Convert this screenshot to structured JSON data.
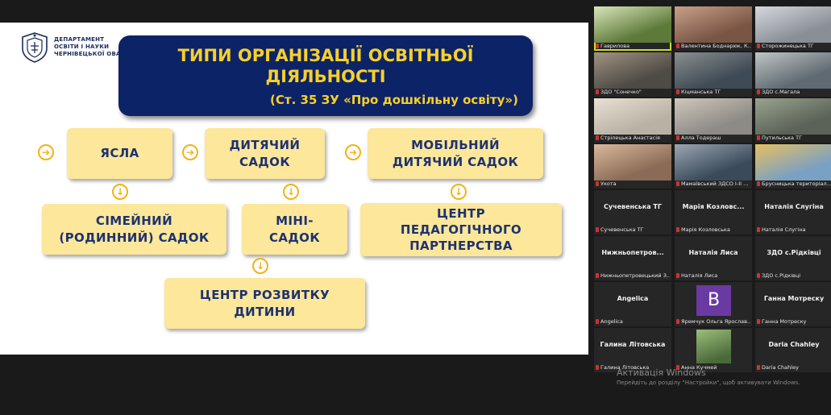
{
  "slide": {
    "department": [
      "ДЕПАРТАМЕНТ",
      "ОСВІТИ І НАУКИ",
      "ЧЕРНІВЕЦЬКОЇ ОВА"
    ],
    "title_line1": "ТИПИ ОРГАНІЗАЦІЇ ОСВІТНЬОЇ",
    "title_line2": "ДІЯЛЬНОСТІ",
    "title_line3": "(Ст. 35 ЗУ «Про дошкільну освіту»)",
    "boxes": {
      "yasla": "ЯСЛА",
      "dytyachyy_l1": "ДИТЯЧИЙ",
      "dytyachyy_l2": "САДОК",
      "mobilnyy_l1": "МОБІЛЬНИЙ",
      "mobilnyy_l2": "ДИТЯЧИЙ САДОК",
      "simeynyy_l1": "СІМЕЙНИЙ",
      "simeynyy_l2": "(РОДИННИЙ) САДОК",
      "mini_l1": "МІНІ-",
      "mini_l2": "САДОК",
      "ped_l1": "ЦЕНТР",
      "ped_l2": "ПЕДАГОГІЧНОГО",
      "ped_l3": "ПАРТНЕРСТВА",
      "rozvytok_l1": "ЦЕНТР РОЗВИТКУ",
      "rozvytok_l2": "ДИТИНИ"
    },
    "arrow_right": "➔",
    "arrow_down": "↓"
  },
  "participants": [
    {
      "name": "Гаврилова",
      "center": ""
    },
    {
      "name": "Валентина Боднарюк, К...",
      "center": ""
    },
    {
      "name": "Сторожинецька ТГ",
      "center": ""
    },
    {
      "name": "ЗДО \"Сонечко\"",
      "center": ""
    },
    {
      "name": "Кіцманська ТГ",
      "center": ""
    },
    {
      "name": "ЗДО с.Магала",
      "center": ""
    },
    {
      "name": "Стрілецька Анастасія",
      "center": ""
    },
    {
      "name": "Алла Тодераш",
      "center": ""
    },
    {
      "name": "Путильська ТГ",
      "center": ""
    },
    {
      "name": "Укота",
      "center": ""
    },
    {
      "name": "Мамаївський ЗДСО І-ІІ ...",
      "center": ""
    },
    {
      "name": "Брусницька територіал...",
      "center": ""
    },
    {
      "name": "Сучевенська ТГ",
      "center": "Сучевенська ТГ"
    },
    {
      "name": "Марія Козловська",
      "center": "Марія Козловс..."
    },
    {
      "name": "Наталія Слугіна",
      "center": "Наталія Слугіна"
    },
    {
      "name": "Нижньопетровецький З...",
      "center": "Нижньопетров..."
    },
    {
      "name": "Наталія Лиса",
      "center": "Наталія Лиса"
    },
    {
      "name": "ЗДО с.Рідківці",
      "center": "ЗДО с.Рідківці"
    },
    {
      "name": "Angelica",
      "center": "Angelica"
    },
    {
      "name": "Яремчук Ольга Ярослав...",
      "center": "",
      "avatar": "B"
    },
    {
      "name": "Ганна Мотреску",
      "center": "Ганна Мотреску"
    },
    {
      "name": "Галина Літовська",
      "center": "Галина Літовська"
    },
    {
      "name": "Анна Кучмей",
      "center": ""
    },
    {
      "name": "Daria Chahley",
      "center": "Daria Chahley"
    }
  ],
  "windows_activation": {
    "title": "Активація Windows",
    "subtitle": "Перейдіть до розділу \"Настройки\", щоб активувати Windows."
  }
}
